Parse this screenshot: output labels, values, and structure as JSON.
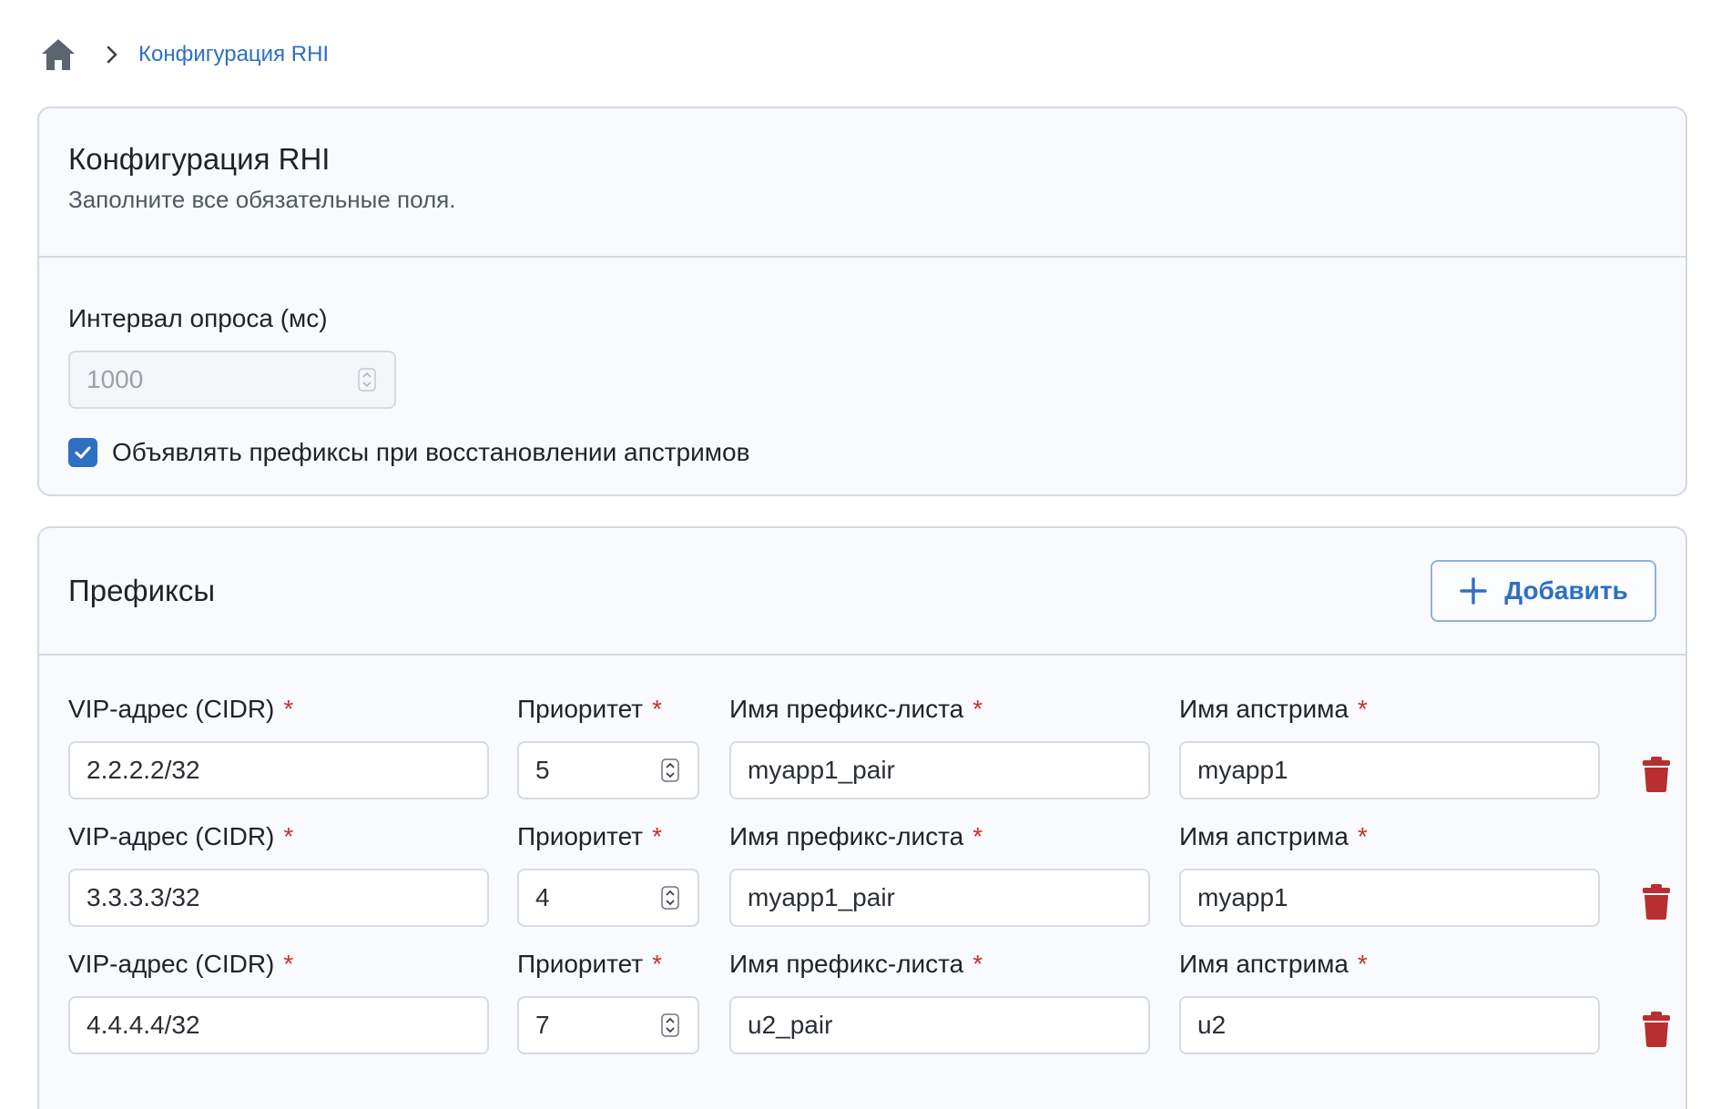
{
  "breadcrumb": {
    "home_icon": "home-icon",
    "separator_icon": "chevron-right-icon",
    "current": "Конфигурация RHI"
  },
  "config": {
    "title": "Конфигурация RHI",
    "subtitle": "Заполните все обязательные поля.",
    "interval_label": "Интервал опроса (мс)",
    "interval_placeholder": "1000",
    "announce_label": "Объявлять префиксы при восстановлении апстримов",
    "announce_checked": true
  },
  "prefixes": {
    "title": "Префиксы",
    "add_label": "Добавить",
    "columns": {
      "vip": "VIP-адрес (CIDR)",
      "priority": "Приоритет",
      "prefix_list": "Имя префикс-листа",
      "upstream": "Имя апстрима",
      "required_mark": "*"
    },
    "rows": [
      {
        "vip": "2.2.2.2/32",
        "priority": "5",
        "prefix_list": "myapp1_pair",
        "upstream": "myapp1"
      },
      {
        "vip": "3.3.3.3/32",
        "priority": "4",
        "prefix_list": "myapp1_pair",
        "upstream": "myapp1"
      },
      {
        "vip": "4.4.4.4/32",
        "priority": "7",
        "prefix_list": "u2_pair",
        "upstream": "u2"
      }
    ]
  },
  "colors": {
    "accent": "#2f6fc2",
    "required": "#c43131",
    "delete": "#b92e2e",
    "panel_bg": "#f8fafd",
    "border": "#d3d9e1"
  }
}
